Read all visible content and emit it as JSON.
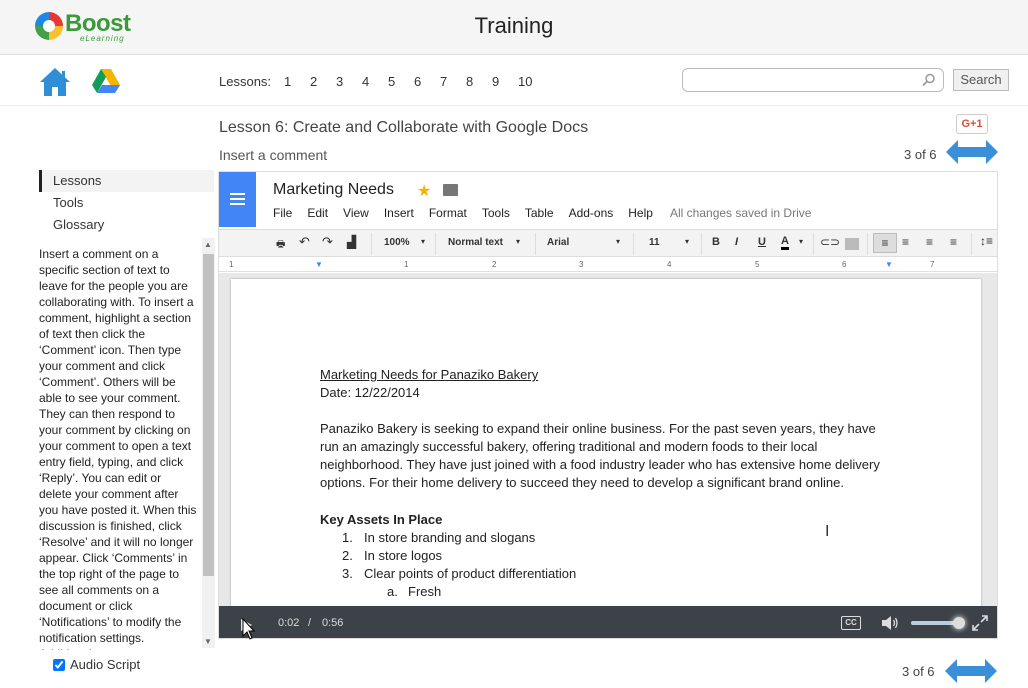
{
  "header": {
    "brand": "Boost",
    "brand_sub": "eLearning",
    "title": "Training"
  },
  "nav": {
    "lessons_label": "Lessons:",
    "lessons": [
      "1",
      "2",
      "3",
      "4",
      "5",
      "6",
      "7",
      "8",
      "9",
      "10"
    ],
    "search_placeholder": "",
    "search_value": "",
    "search_button": "Search",
    "icons": [
      "home-icon",
      "google-drive-icon",
      "search-icon"
    ]
  },
  "lesson": {
    "title": "Lesson 6: Create and Collaborate with Google Docs",
    "subtitle": "Insert a comment",
    "gplus": "G+1",
    "page_counter": "3 of 6"
  },
  "sidebar": {
    "items": [
      {
        "label": "Lessons",
        "active": true
      },
      {
        "label": "Tools",
        "active": false
      },
      {
        "label": "Glossary",
        "active": false
      }
    ],
    "instructions": "Insert a comment on a specific section of text to leave for the people you are collaborating with. To insert a comment, highlight a section of text then click the ‘Comment’ icon. Then type your comment and click ‘Comment’. Others will be able to see your comment. They can then respond to your comment by clicking on your comment to open a text entry field, typing, and click ‘Reply’. You can edit or delete your comment after you have posted it. When this discussion is finished, click ‘Resolve’ and it will no longer appear. Click ‘Comments’ in the top right of the page to see all comments on a document or click ‘Notifications’ to modify the notification settings. Additional",
    "audio_script_label": "Audio Script",
    "audio_script_checked": true
  },
  "docs": {
    "doc_name": "Marketing Needs",
    "menu": [
      "File",
      "Edit",
      "View",
      "Insert",
      "Format",
      "Tools",
      "Table",
      "Add-ons",
      "Help"
    ],
    "saved_status": "All changes saved in Drive",
    "toolbar": {
      "zoom": "100%",
      "style": "Normal text",
      "font": "Arial",
      "size": "11"
    },
    "ruler_marks": [
      "1",
      "1",
      "2",
      "3",
      "4",
      "5",
      "6",
      "7"
    ],
    "content": {
      "heading": "Marketing Needs for Panaziko Bakery",
      "date": "Date: 12/22/2014",
      "paragraph_lines": [
        "Panaziko Bakery is seeking to expand their online business.  For the past seven years, they have",
        "run an amazingly successful bakery, offering traditional and modern foods to their local",
        "neighborhood.  They have just joined with a food industry leader who has extensive home delivery",
        "options.  For their home delivery to succeed they need to develop a significant brand online."
      ],
      "section_title": "Key Assets In Place",
      "list": [
        {
          "num": "1.",
          "text": "In store branding and slogans"
        },
        {
          "num": "2.",
          "text": "In store logos"
        },
        {
          "num": "3.",
          "text": "Clear points of product differentiation"
        }
      ],
      "sublist": [
        {
          "num": "a.",
          "text": "Fresh"
        }
      ]
    }
  },
  "player": {
    "current_time": "0:02",
    "separator": "/",
    "duration": "0:56",
    "progress_fraction": 0.036,
    "volume_fraction": 0.85,
    "cc_label": "CC"
  },
  "colors": {
    "brand_green": "#3a9a3a",
    "arrow_blue": "#3a8fd8",
    "docs_blue": "#4285f4",
    "player_bg": "#3c4248"
  }
}
